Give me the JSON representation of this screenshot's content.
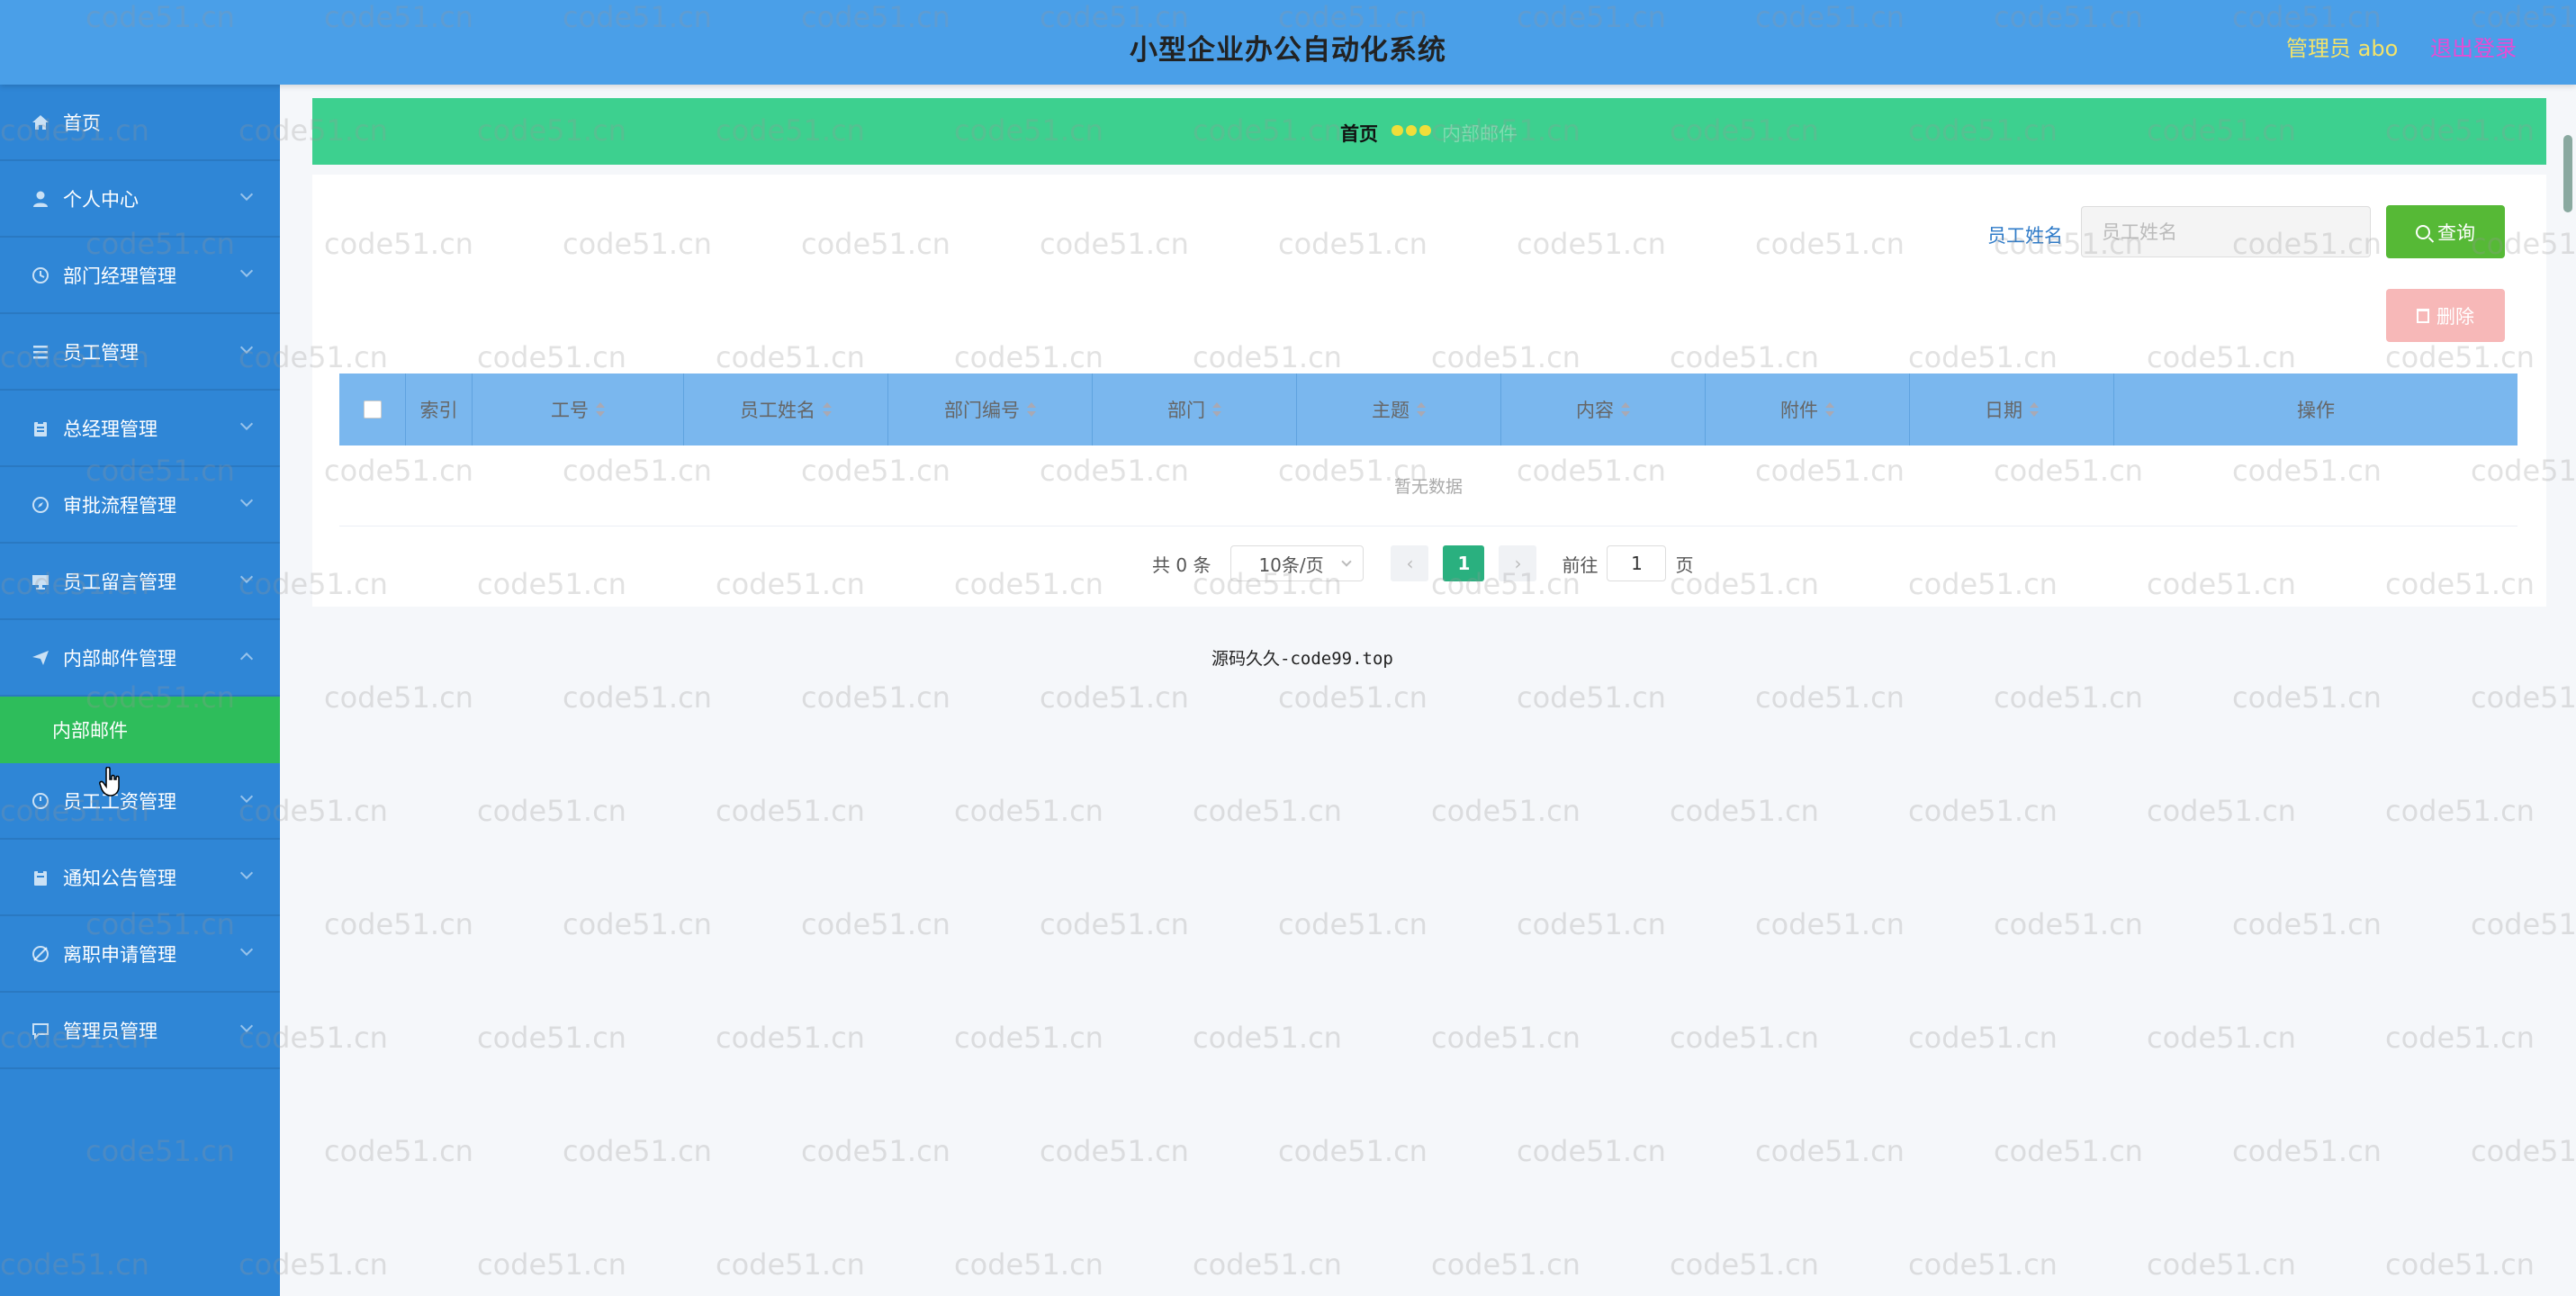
{
  "header": {
    "title": "小型企业办公自动化系统",
    "user": "管理员 abo",
    "logout": "退出登录"
  },
  "sidebar": {
    "items": [
      {
        "label": "首页",
        "icon": "home-icon",
        "expandable": false
      },
      {
        "label": "个人中心",
        "icon": "user-icon",
        "expandable": true
      },
      {
        "label": "部门经理管理",
        "icon": "clock-icon",
        "expandable": true
      },
      {
        "label": "员工管理",
        "icon": "list-icon",
        "expandable": true
      },
      {
        "label": "总经理管理",
        "icon": "clipboard-icon",
        "expandable": true
      },
      {
        "label": "审批流程管理",
        "icon": "compass-icon",
        "expandable": true
      },
      {
        "label": "员工留言管理",
        "icon": "monitor-icon",
        "expandable": true
      },
      {
        "label": "内部邮件管理",
        "icon": "send-icon",
        "expandable": true,
        "expanded": true
      },
      {
        "label": "员工工资管理",
        "icon": "clock-icon",
        "expandable": true
      },
      {
        "label": "通知公告管理",
        "icon": "clipboard-icon",
        "expandable": true
      },
      {
        "label": "离职申请管理",
        "icon": "compass-off-icon",
        "expandable": true
      },
      {
        "label": "管理员管理",
        "icon": "chat-icon",
        "expandable": true
      }
    ],
    "submenu": {
      "label": "内部邮件"
    }
  },
  "breadcrumb": {
    "home": "首页",
    "current": "内部邮件"
  },
  "search": {
    "label": "员工姓名",
    "placeholder": "员工姓名",
    "value": "",
    "search_button": "查询",
    "delete_button": "删除"
  },
  "table": {
    "columns": [
      "索引",
      "工号",
      "员工姓名",
      "部门编号",
      "部门",
      "主题",
      "内容",
      "附件",
      "日期",
      "操作"
    ],
    "empty_text": "暂无数据"
  },
  "pagination": {
    "total": "共 0 条",
    "page_size": "10条/页",
    "current_page": "1",
    "goto_label": "前往",
    "goto_value": "1",
    "page_unit": "页"
  },
  "footer": {
    "text": "源码久久-code99.top"
  },
  "watermark": {
    "text": "code51.cn"
  },
  "colors": {
    "header": "#4a9fe8",
    "sidebar": "#2f86d6",
    "submenu_active": "#2ebd5b",
    "breadcrumb_bar": "#3dd08f",
    "table_header": "#7ab7ee",
    "search_button": "#56b936",
    "delete_button": "#f7b8b8",
    "page_active": "#2ab07f"
  }
}
